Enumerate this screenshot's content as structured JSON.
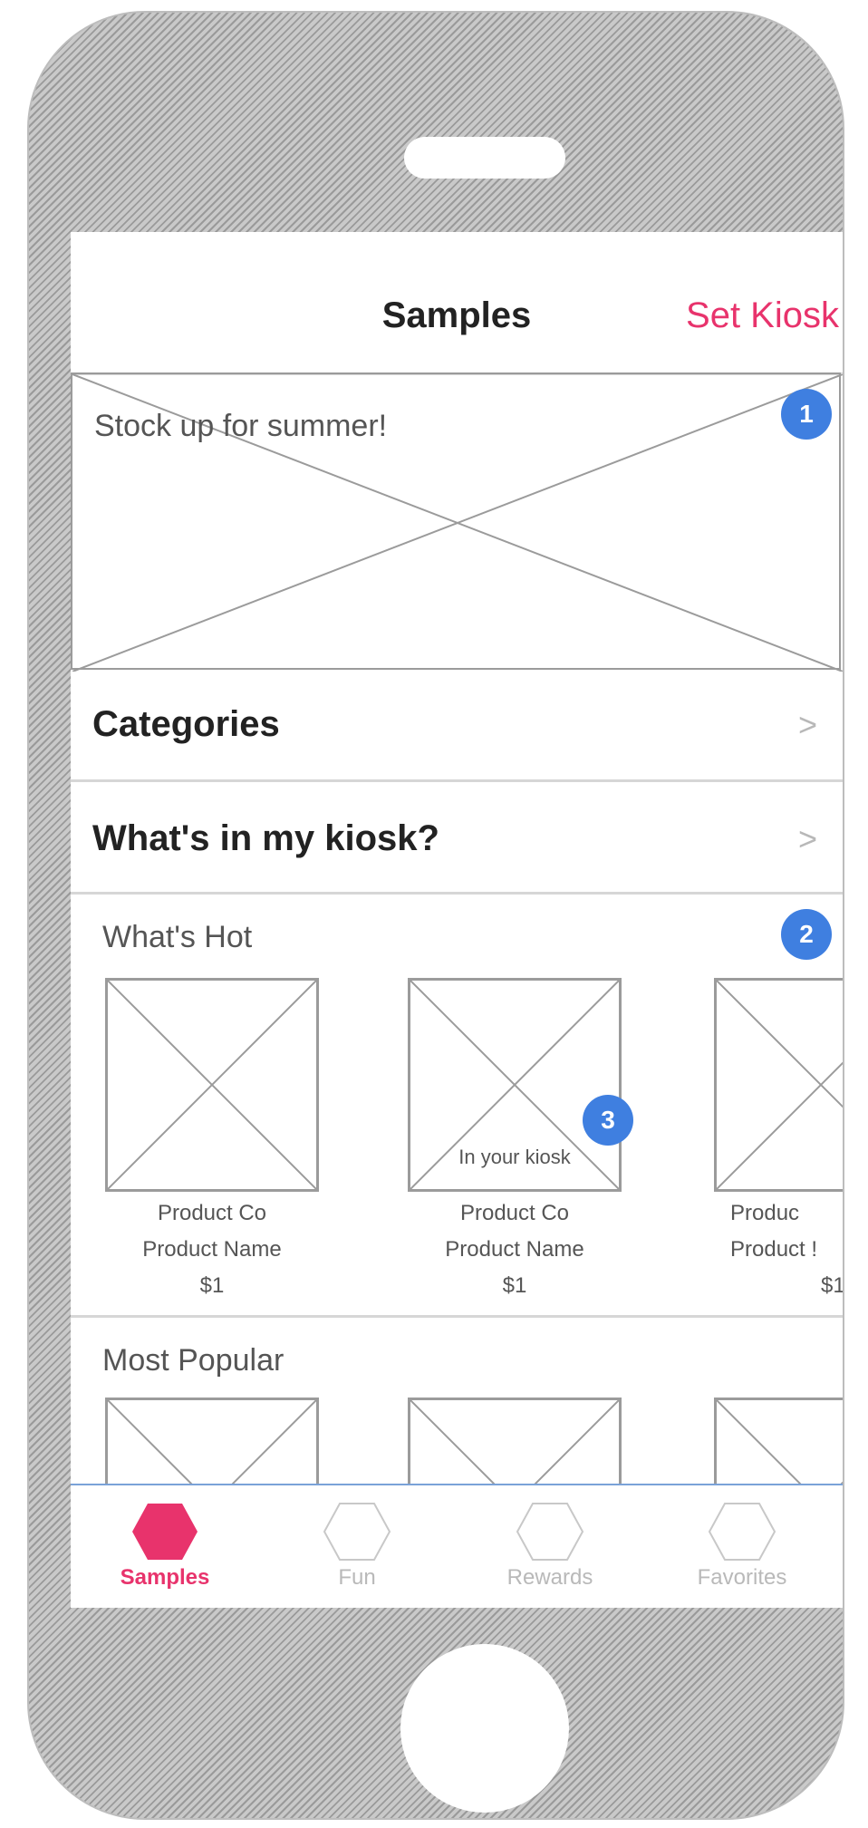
{
  "navbar": {
    "title": "Samples",
    "action": "Set Kiosk"
  },
  "hero": {
    "text": "Stock up for summer!"
  },
  "badges": {
    "hero": "1",
    "whats_hot": "2",
    "in_kiosk": "3"
  },
  "rows": [
    {
      "label": "Categories",
      "chevron": ">"
    },
    {
      "label": "What's in my kiosk?",
      "chevron": ">"
    }
  ],
  "sections": {
    "whats_hot": {
      "title": "What's Hot",
      "products": [
        {
          "company": "Product Co",
          "name": "Product Name",
          "price": "$1",
          "tag": ""
        },
        {
          "company": "Product Co",
          "name": "Product Name",
          "price": "$1",
          "tag": "In your kiosk"
        },
        {
          "company": "Produc",
          "name": "Product !",
          "price": "$1",
          "tag": ""
        }
      ]
    },
    "most_popular": {
      "title": "Most Popular"
    }
  },
  "tabs": [
    {
      "label": "Samples",
      "active": true
    },
    {
      "label": "Fun",
      "active": false
    },
    {
      "label": "Rewards",
      "active": false
    },
    {
      "label": "Favorites",
      "active": false
    }
  ],
  "colors": {
    "accent": "#e8336c",
    "badge": "#3f7fe0",
    "tab_inactive": "#b9b9b9"
  }
}
